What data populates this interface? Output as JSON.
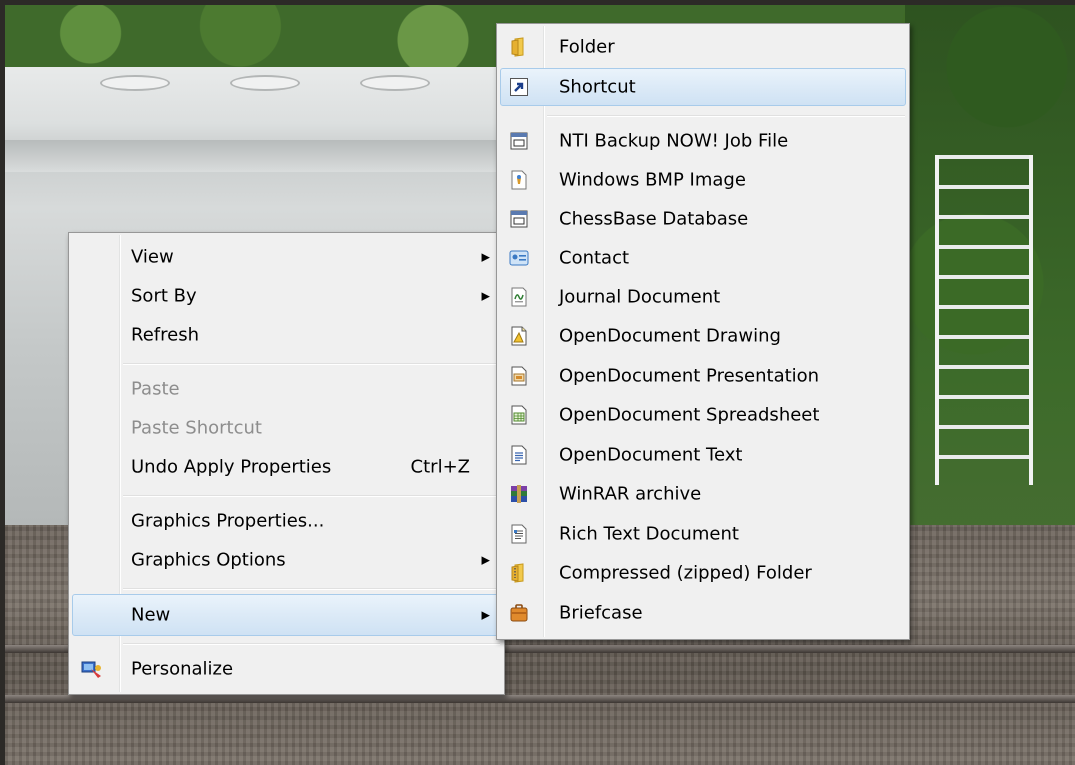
{
  "main_menu": {
    "items": [
      {
        "label": "View",
        "has_submenu": true
      },
      {
        "label": "Sort By",
        "has_submenu": true
      },
      {
        "label": "Refresh"
      },
      {
        "label": "Paste",
        "disabled": true
      },
      {
        "label": "Paste Shortcut",
        "disabled": true
      },
      {
        "label": "Undo Apply Properties",
        "shortcut": "Ctrl+Z"
      },
      {
        "label": "Graphics Properties..."
      },
      {
        "label": "Graphics Options",
        "has_submenu": true
      },
      {
        "label": "New",
        "has_submenu": true,
        "highlighted": true
      },
      {
        "label": "Personalize",
        "icon": "personalize-icon"
      }
    ],
    "arrow_glyph": "▶"
  },
  "new_submenu": {
    "items": [
      {
        "label": "Folder",
        "icon": "folder-icon"
      },
      {
        "label": "Shortcut",
        "icon": "shortcut-icon",
        "highlighted": true
      },
      {
        "label": "NTI Backup NOW! Job File",
        "icon": "nti-backup-file-icon"
      },
      {
        "label": "Windows BMP Image",
        "icon": "bmp-image-icon"
      },
      {
        "label": "ChessBase Database",
        "icon": "chessbase-database-icon"
      },
      {
        "label": "Contact",
        "icon": "contact-icon"
      },
      {
        "label": "Journal Document",
        "icon": "journal-document-icon"
      },
      {
        "label": "OpenDocument Drawing",
        "icon": "opendocument-drawing-icon"
      },
      {
        "label": "OpenDocument Presentation",
        "icon": "opendocument-presentation-icon"
      },
      {
        "label": "OpenDocument Spreadsheet",
        "icon": "opendocument-spreadsheet-icon"
      },
      {
        "label": "OpenDocument Text",
        "icon": "opendocument-text-icon"
      },
      {
        "label": "WinRAR archive",
        "icon": "winrar-archive-icon"
      },
      {
        "label": "Rich Text Document",
        "icon": "rich-text-document-icon"
      },
      {
        "label": "Compressed (zipped) Folder",
        "icon": "zipped-folder-icon"
      },
      {
        "label": "Briefcase",
        "icon": "briefcase-icon"
      }
    ]
  },
  "colors": {
    "menu_background": "#f0f0f0",
    "menu_border": "#979797",
    "highlight_top": "#eaf3fb",
    "highlight_bottom": "#cfe2f4",
    "highlight_border": "#a8cbea",
    "disabled_text": "#8d8d8d"
  }
}
